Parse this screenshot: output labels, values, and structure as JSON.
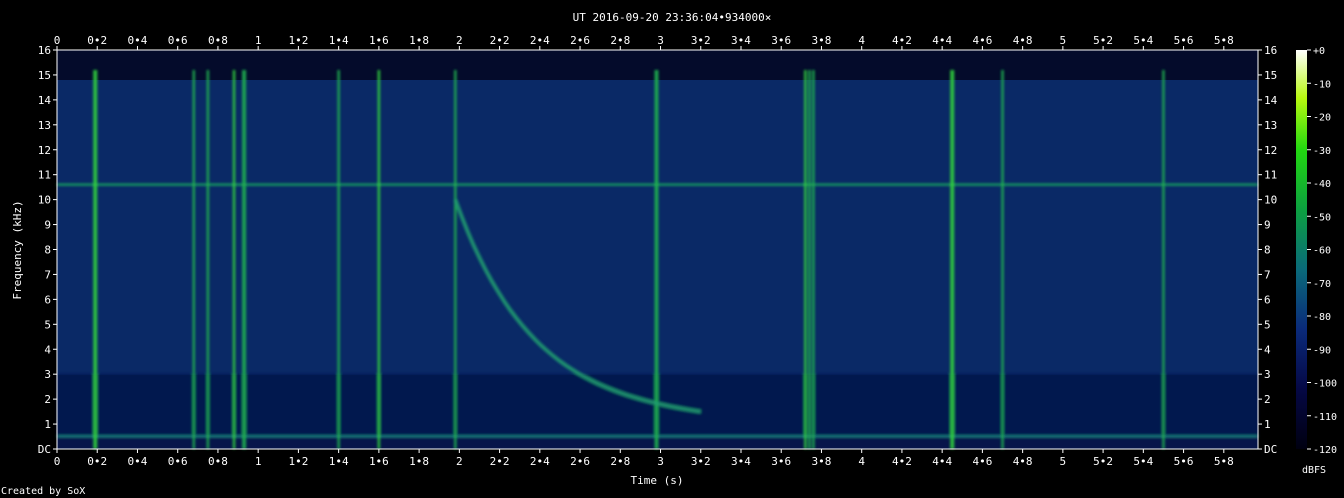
{
  "chart_data": {
    "type": "heatmap",
    "title": "UT 2016-09-20 23:36:04•934000×",
    "xlabel": "Time (s)",
    "ylabel": "Frequency (kHz)",
    "xlim": [
      0,
      5.97
    ],
    "ylim": [
      0,
      16
    ],
    "x_ticks": [
      "0",
      "0•2",
      "0•4",
      "0•6",
      "0•8",
      "1",
      "1•2",
      "1•4",
      "1•6",
      "1•8",
      "2",
      "2•2",
      "2•4",
      "2•6",
      "2•8",
      "3",
      "3•2",
      "3•4",
      "3•6",
      "3•8",
      "4",
      "4•2",
      "4•4",
      "4•6",
      "4•8",
      "5",
      "5•2",
      "5•4",
      "5•6",
      "5•8"
    ],
    "x_tick_values": [
      0,
      0.2,
      0.4,
      0.6,
      0.8,
      1,
      1.2,
      1.4,
      1.6,
      1.8,
      2,
      2.2,
      2.4,
      2.6,
      2.8,
      3,
      3.2,
      3.4,
      3.6,
      3.8,
      4,
      4.2,
      4.4,
      4.6,
      4.8,
      5,
      5.2,
      5.4,
      5.6,
      5.8
    ],
    "y_ticks": [
      "DC",
      "1",
      "2",
      "3",
      "4",
      "5",
      "6",
      "7",
      "8",
      "9",
      "10",
      "11",
      "12",
      "13",
      "14",
      "15",
      "16"
    ],
    "y_tick_values": [
      0,
      1,
      2,
      3,
      4,
      5,
      6,
      7,
      8,
      9,
      10,
      11,
      12,
      13,
      14,
      15,
      16
    ],
    "colorbar": {
      "label": "dBFS",
      "ticks": [
        "+0",
        "-10",
        "-20",
        "-30",
        "-40",
        "-50",
        "-60",
        "-70",
        "-80",
        "-90",
        "-100",
        "-110",
        "-120"
      ],
      "tick_values": [
        0,
        -10,
        -20,
        -30,
        -40,
        -50,
        -60,
        -70,
        -80,
        -90,
        -100,
        -110,
        -120
      ],
      "range": [
        -120,
        0
      ]
    },
    "features": {
      "background_level_dbfs": -95,
      "steady_tone_khz": 10.6,
      "low_band_khz": [
        0.5,
        3
      ],
      "impulse_times_s": [
        0.19,
        0.68,
        0.75,
        0.88,
        0.93,
        1.4,
        1.6,
        1.98,
        2.98,
        3.72,
        3.74,
        3.76,
        4.45,
        4.7,
        5.5
      ],
      "whistler_sweep": {
        "start_s": 1.98,
        "end_s": 3.2,
        "start_khz": 10,
        "end_khz": 1.5
      }
    },
    "grid": false,
    "legend": "colorbar at right"
  },
  "footer": {
    "credit": "Created by SoX"
  }
}
